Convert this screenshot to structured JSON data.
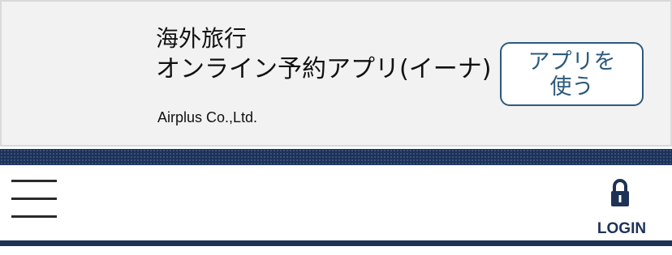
{
  "app_banner": {
    "title": "海外旅行",
    "subtitle": "オンライン予約アプリ(イーナ)",
    "company": "Airplus Co.,Ltd.",
    "button_line1": "アプリを",
    "button_line2": "使う"
  },
  "nav": {
    "menu_icon": "hamburger-icon",
    "login_icon": "lock-icon",
    "login_label": "LOGIN"
  },
  "colors": {
    "brand_navy": "#1e3257",
    "button_blue": "#2d5a7b",
    "banner_bg": "#f2f2f2"
  }
}
